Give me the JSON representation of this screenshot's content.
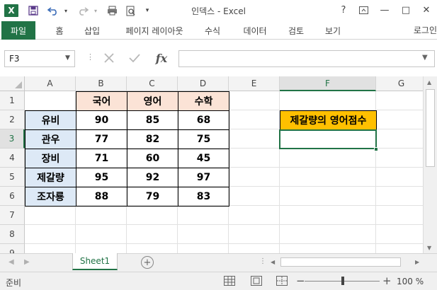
{
  "window": {
    "title": "인덱스 - Excel",
    "app_logo": "X",
    "help_label": "?",
    "minimize_label": "—",
    "restore_label": "□",
    "close_label": "✕"
  },
  "quick_access": {
    "save_icon": "save-icon",
    "undo_icon": "undo-icon",
    "redo_icon": "redo-icon"
  },
  "ribbon": {
    "tabs": [
      "파일",
      "홈",
      "삽입",
      "페이지 레이아웃",
      "수식",
      "데이터",
      "검토",
      "보기"
    ],
    "login_label": "로그인"
  },
  "formula_bar": {
    "name_box": "F3",
    "fx_label": "fx",
    "formula_value": ""
  },
  "sheet": {
    "columns": [
      "A",
      "B",
      "C",
      "D",
      "E",
      "F",
      "G"
    ],
    "rows": [
      "1",
      "2",
      "3",
      "4",
      "5",
      "6",
      "7",
      "8",
      "9"
    ],
    "selected_cell": "F3",
    "subject_headers": [
      "국어",
      "영어",
      "수학"
    ],
    "students": [
      {
        "name": "유비",
        "scores": [
          "90",
          "85",
          "68"
        ]
      },
      {
        "name": "관우",
        "scores": [
          "77",
          "82",
          "75"
        ]
      },
      {
        "name": "장비",
        "scores": [
          "71",
          "60",
          "45"
        ]
      },
      {
        "name": "제갈량",
        "scores": [
          "95",
          "92",
          "97"
        ]
      },
      {
        "name": "조자룡",
        "scores": [
          "88",
          "79",
          "83"
        ]
      }
    ],
    "lookup_title": "제갈량의 영어점수",
    "lookup_result": ""
  },
  "tabs_bar": {
    "sheet_name": "Sheet1",
    "add_label": "+"
  },
  "status_bar": {
    "mode": "준비",
    "zoom_minus": "−",
    "zoom_plus": "+",
    "zoom_level": "100 %"
  },
  "colors": {
    "accent": "#217346",
    "subject_header_fill": "#fbe3d6",
    "name_fill": "#dde9f6",
    "lookup_fill": "#ffc000"
  }
}
